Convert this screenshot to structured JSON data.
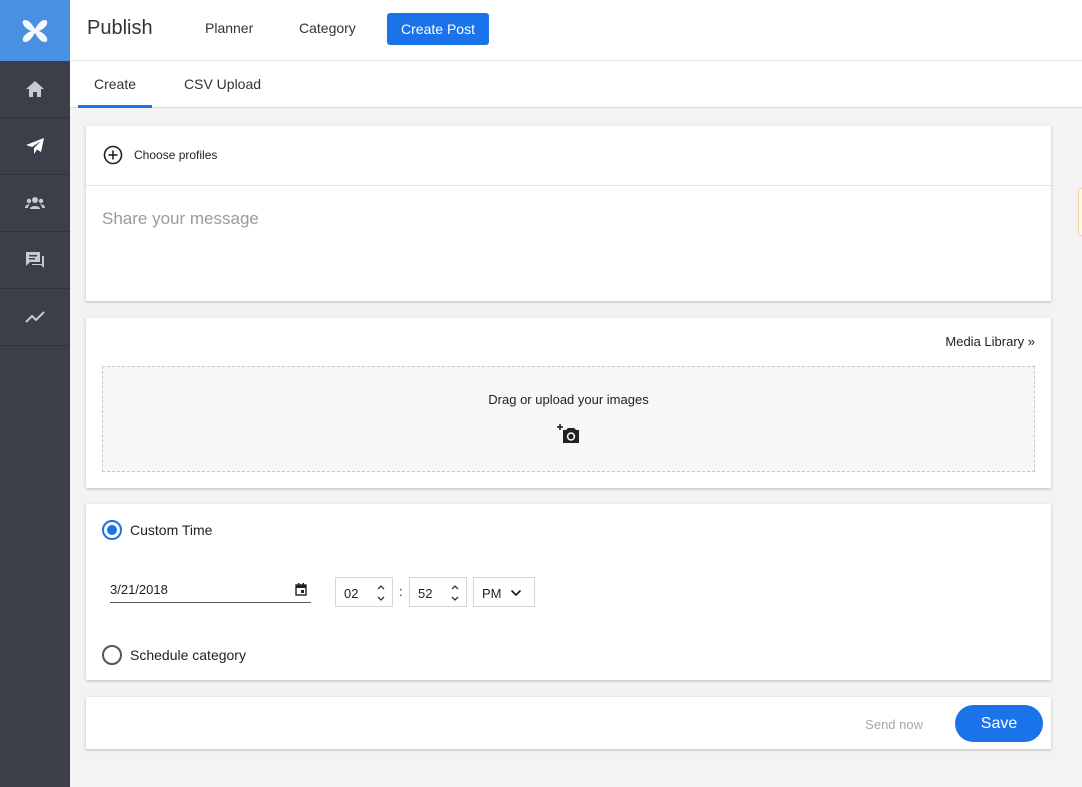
{
  "app": {
    "title": "Publish"
  },
  "sidebar": {
    "items": [
      {
        "icon": "home-icon"
      },
      {
        "icon": "paper-plane-icon"
      },
      {
        "icon": "people-icon"
      },
      {
        "icon": "chat-icon"
      },
      {
        "icon": "trend-line-icon"
      }
    ]
  },
  "topnav": {
    "links": [
      "Planner",
      "Category"
    ],
    "create_post": "Create Post"
  },
  "tabs": [
    {
      "label": "Create",
      "active": true
    },
    {
      "label": "CSV Upload",
      "active": false
    }
  ],
  "compose": {
    "choose_profiles": "Choose profiles",
    "message_placeholder": "Share your message",
    "message_value": ""
  },
  "media": {
    "library_link": "Media Library »",
    "drop_text": "Drag or upload your images"
  },
  "schedule": {
    "custom_time_label": "Custom Time",
    "custom_time_selected": true,
    "date": "3/21/2018",
    "hour": "02",
    "minute": "52",
    "time_separator": ":",
    "ampm": "PM",
    "category_label": "Schedule category",
    "category_selected": false
  },
  "actions": {
    "send_now": "Send now",
    "save": "Save"
  },
  "colors": {
    "accent": "#1a73e8",
    "sidebar": "#3b3f4a",
    "logo_bg": "#4a90e2"
  }
}
